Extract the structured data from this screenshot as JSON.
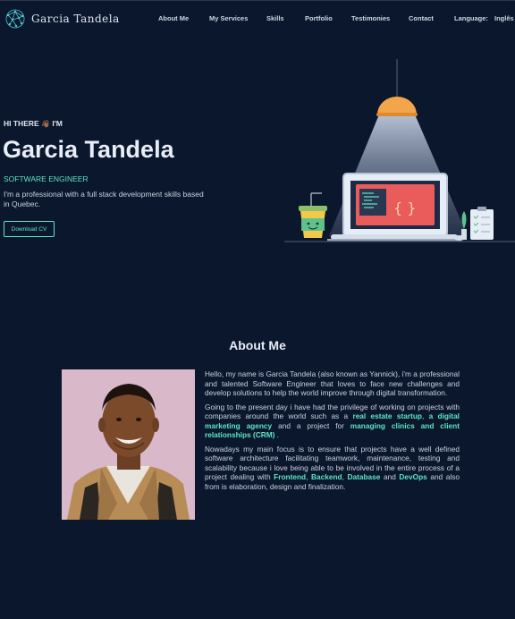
{
  "nav": {
    "brand": "Garcia Tandela",
    "links": [
      "About Me",
      "My Services",
      "Skills",
      "Portfolio",
      "Testimonies",
      "Contact"
    ],
    "language_label": "Language:",
    "language_value": "Inglês"
  },
  "hero": {
    "greeting": "HI THERE",
    "greeting_emoji": "👋🏾",
    "greeting_suffix": "I'M",
    "name": "Garcia Tandela",
    "role": "SOFTWARE ENGINEER",
    "description": "I'm a professional with a full stack development skills based in Quebec.",
    "cv_button": "Download CV"
  },
  "about": {
    "title": "About Me",
    "p1": "Hello, my name is Garcia Tandela (also known as Yannick), i'm a professional and talented Software Engineer that loves to face new challenges and develop solutions to help the world improve through digital transformation.",
    "p2_pre": "Going to the present day i have had the privilege of working on projects with companies around the world such as a ",
    "p2_hl1": "real estate startup",
    "p2_sep1": ", ",
    "p2_hl2": "a digital marketing agency",
    "p2_mid": " and a project for ",
    "p2_hl3": "managing clinics and client relationships (CRM)",
    "p2_end": " .",
    "p3_pre": "Nowadays my main focus is to ensure that projects have a well defined software architecture facilitating teamwork, maintenance, testing and scalability because i love being able to be involved in the entire process of a project dealing with ",
    "p3_hl1": "Frontend",
    "p3_sep1": ", ",
    "p3_hl2": "Backend",
    "p3_sep2": ", ",
    "p3_hl3": "Database",
    "p3_and": " and ",
    "p3_hl4": "DevOps",
    "p3_end": " and also from is elaboration, design and finalization."
  },
  "colors": {
    "background": "#0b172c",
    "accent": "#5ce6c7",
    "text": "#dfe6f3"
  },
  "icons": {
    "logo": "network-globe-icon",
    "illustration": "developer-desk-illustration"
  }
}
